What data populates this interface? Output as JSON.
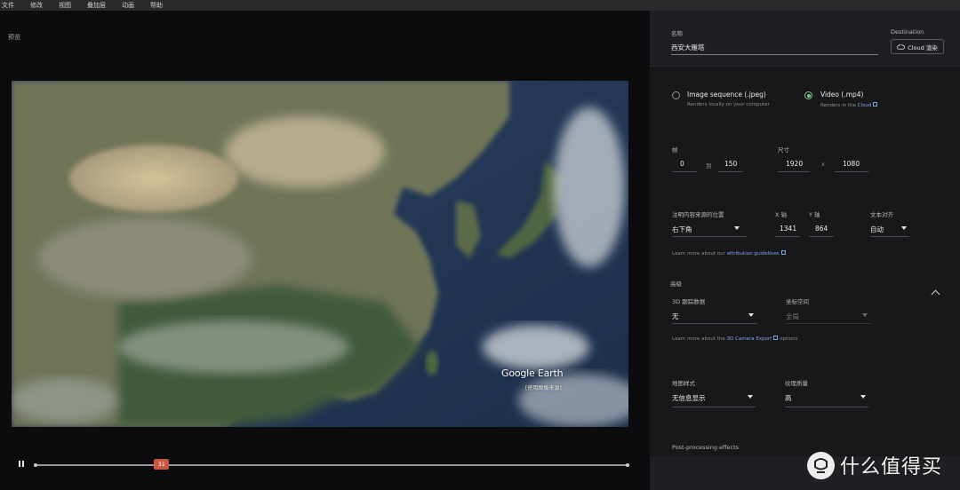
{
  "menu": [
    "文件",
    "修改",
    "视图",
    "叠加层",
    "动画",
    "帮助"
  ],
  "preview": {
    "title": "预览",
    "logo": "Google Earth",
    "credit": "[使用图像来源]"
  },
  "timeline": {
    "current_frame": "31",
    "start": 0,
    "end": 150,
    "progress": 0.213
  },
  "panel": {
    "name_label": "名称",
    "name_value": "西安大雁塔",
    "destination_label": "Destination",
    "destination_button": "Cloud 渲染",
    "output": {
      "jpeg_label": "Image sequence (.jpeg)",
      "jpeg_sub": "Renders locally on your computer",
      "mp4_label": "Video (.mp4)",
      "mp4_sub_prefix": "Renders in the",
      "mp4_sub_link": "Cloud",
      "selected": "mp4"
    },
    "frames": {
      "label": "帧",
      "from": "0",
      "to_label": "到",
      "to": "150"
    },
    "size": {
      "label": "尺寸",
      "width": "1920",
      "x_label": "x",
      "height": "1080"
    },
    "attribution": {
      "position_label": "注明内容来源的位置",
      "position_value": "右下角",
      "x_label": "X 轴",
      "x_value": "1341",
      "y_label": "Y 轴",
      "y_value": "864",
      "align_label": "文本对齐",
      "align_value": "自动",
      "learn_prefix": "Learn more about our",
      "learn_link": "attribution guidelines"
    },
    "advanced": {
      "label": "高级",
      "tracking_label": "3D 跟踪数据",
      "tracking_value": "无",
      "coord_label": "坐标空间",
      "coord_value": "全局",
      "learn_prefix": "Learn more about the",
      "learn_link": "3D Camera Export",
      "learn_suffix": "options"
    },
    "map": {
      "style_label": "地图样式",
      "style_value": "无信息显示",
      "texture_label": "纹理质量",
      "texture_value": "高"
    },
    "post_label": "Post-processing effects"
  },
  "watermark": {
    "text": "什么值得买"
  }
}
